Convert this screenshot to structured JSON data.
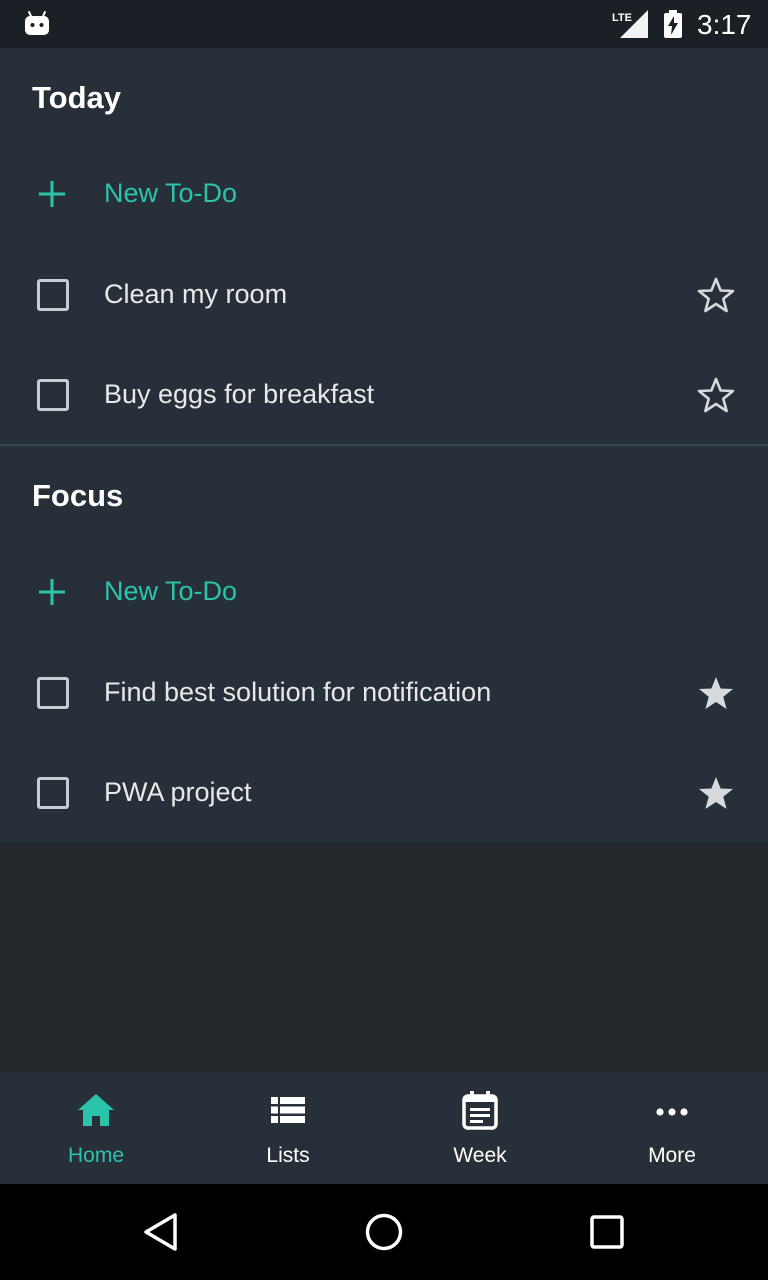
{
  "status_bar": {
    "time": "3:17",
    "network": "LTE",
    "icons": [
      "android-icon",
      "lte-signal-icon",
      "battery-charging-icon"
    ]
  },
  "sections": [
    {
      "title": "Today",
      "new_label": "New To-Do",
      "tasks": [
        {
          "label": "Clean my room",
          "starred": false
        },
        {
          "label": "Buy eggs for breakfast",
          "starred": false
        }
      ]
    },
    {
      "title": "Focus",
      "new_label": "New To-Do",
      "tasks": [
        {
          "label": "Find best solution for notification",
          "starred": true
        },
        {
          "label": "PWA project",
          "starred": true
        }
      ]
    }
  ],
  "bottom_nav": [
    {
      "label": "Home",
      "icon": "home-icon",
      "active": true
    },
    {
      "label": "Lists",
      "icon": "list-icon",
      "active": false
    },
    {
      "label": "Week",
      "icon": "calendar-icon",
      "active": false
    },
    {
      "label": "More",
      "icon": "more-icon",
      "active": false
    }
  ],
  "colors": {
    "accent": "#2bc3a9",
    "background": "#23282d",
    "surface": "#273038",
    "status_bar": "#1b2026"
  }
}
